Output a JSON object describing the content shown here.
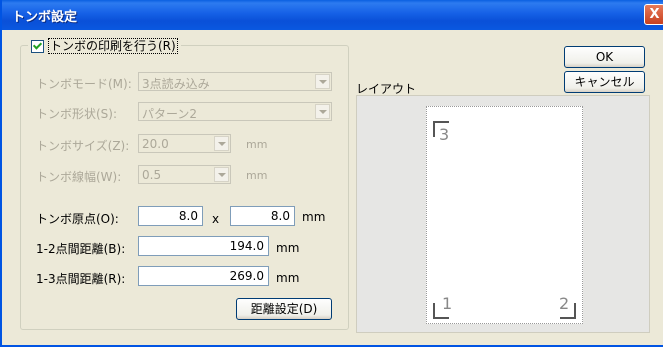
{
  "window": {
    "title": "トンボ設定",
    "close_glyph": "X"
  },
  "group": {
    "enable_label": "トンボの印刷を行う(R)",
    "checked": true
  },
  "fields": {
    "mode": {
      "label": "トンボモード(M):",
      "value": "3点読み込み"
    },
    "shape": {
      "label": "トンボ形状(S):",
      "value": "パターン2"
    },
    "size": {
      "label": "トンボサイズ(Z):",
      "value": "20.0",
      "unit": "mm"
    },
    "line_width": {
      "label": "トンボ線幅(W):",
      "value": "0.5",
      "unit": "mm"
    },
    "origin": {
      "label": "トンボ原点(O):",
      "x_value": "8.0",
      "separator": "x",
      "y_value": "8.0",
      "unit": "mm"
    },
    "dist_12": {
      "label": "1-2点間距離(B):",
      "value": "194.0",
      "unit": "mm"
    },
    "dist_13": {
      "label": "1-3点間距離(R):",
      "value": "269.0",
      "unit": "mm"
    }
  },
  "buttons": {
    "distance_settings": "距離設定(D)",
    "ok": "OK",
    "cancel": "キャンセル"
  },
  "layout_preview": {
    "label": "レイアウト",
    "mark_1": "1",
    "mark_2": "2",
    "mark_3": "3"
  }
}
